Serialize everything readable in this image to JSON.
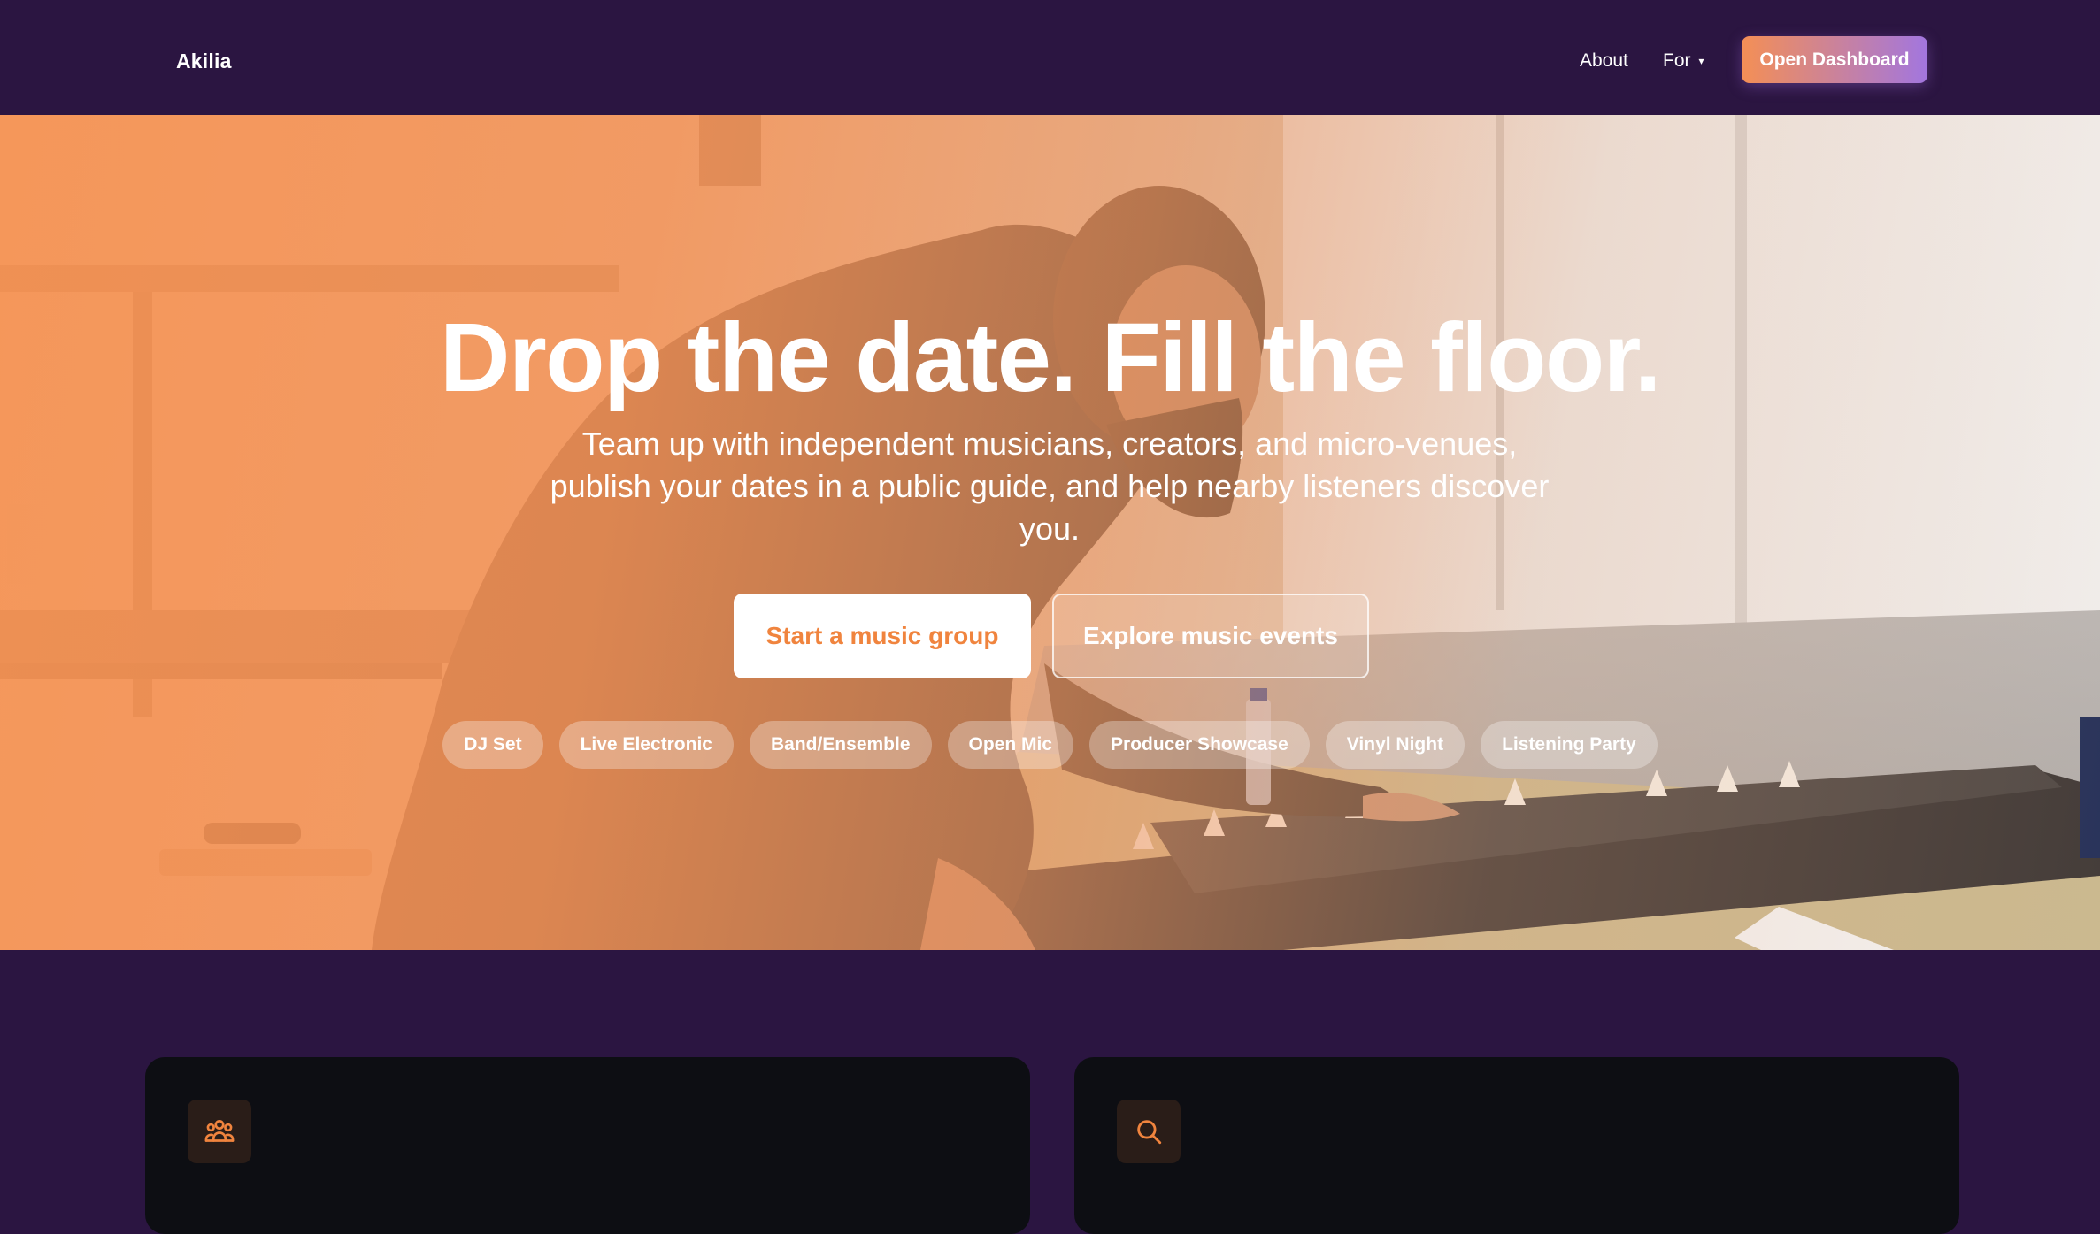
{
  "nav": {
    "brand": "Akilia",
    "links": [
      {
        "label": "About"
      },
      {
        "label": "For",
        "caret": "▾"
      }
    ],
    "cta": "Open Dashboard"
  },
  "hero": {
    "title": "Drop the date. Fill the floor.",
    "subtitle": "Team up with independent musicians, creators, and micro-venues, publish your dates in a public guide, and help nearby listeners discover you.",
    "primary_button": "Start a music group",
    "secondary_button": "Explore music events",
    "tags": [
      "DJ Set",
      "Live Electronic",
      "Band/Ensemble",
      "Open Mic",
      "Producer Showcase",
      "Vinyl Night",
      "Listening Party"
    ]
  },
  "features": [
    {
      "icon": "group-icon"
    },
    {
      "icon": "search-icon"
    }
  ],
  "colors": {
    "nav_bg": "#2b1541",
    "accent_orange": "#f0843e",
    "accent_purple": "#a276df",
    "card_bg": "#0d0e13"
  }
}
